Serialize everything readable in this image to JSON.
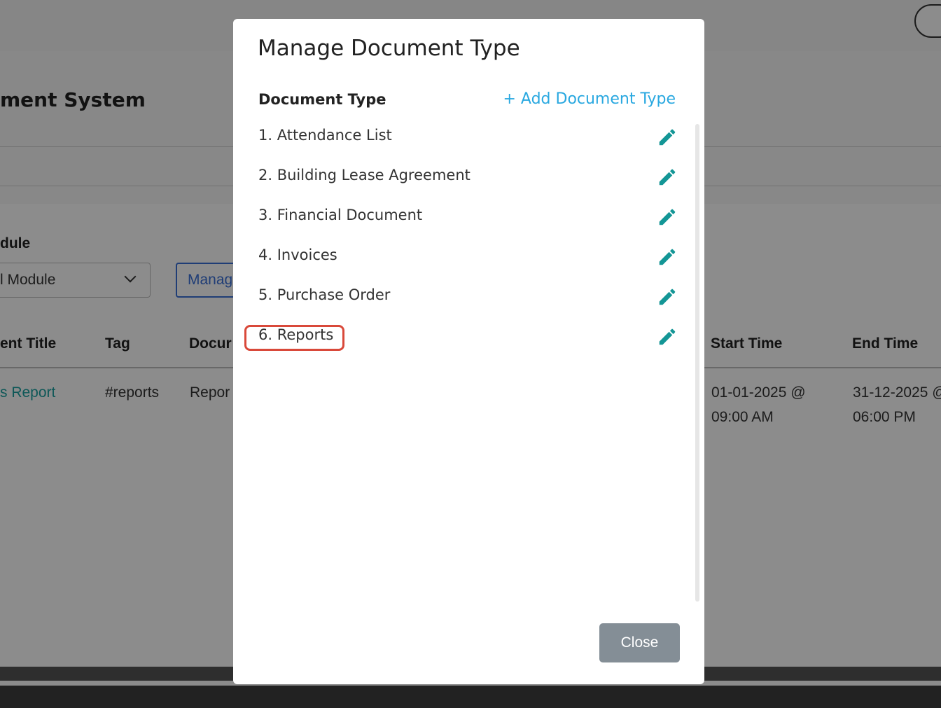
{
  "background": {
    "page_title": "ment System",
    "module_label": "dule",
    "module_select_value": "l Module",
    "manage_button_label": "Manag",
    "table_headers": [
      "ent Title",
      "Tag",
      "Docur",
      "Start Time",
      "End Time"
    ],
    "row": {
      "title": "s Report",
      "tag": "#reports",
      "doc": "Repor",
      "start_line1": "01-01-2025 @",
      "start_line2": "09:00 AM",
      "end_line1": "31-12-2025 @",
      "end_line2": "06:00 PM"
    }
  },
  "modal": {
    "title": "Manage Document Type",
    "column_header": "Document Type",
    "add_link": "+ Add Document Type",
    "items": [
      {
        "label": "1. Attendance List",
        "icon": "pencil-icon"
      },
      {
        "label": "2. Building Lease Agreement",
        "icon": "pencil-icon"
      },
      {
        "label": "3. Financial Document",
        "icon": "pencil-icon"
      },
      {
        "label": "4. Invoices",
        "icon": "pencil-icon"
      },
      {
        "label": "5. Purchase Order",
        "icon": "pencil-icon"
      },
      {
        "label": "6. Reports",
        "icon": "pencil-icon"
      }
    ],
    "close_label": "Close"
  },
  "colors": {
    "accent_link": "#29a8e0",
    "edit_icon": "#139696",
    "highlight": "#d9493a",
    "close_button": "#848e96"
  }
}
